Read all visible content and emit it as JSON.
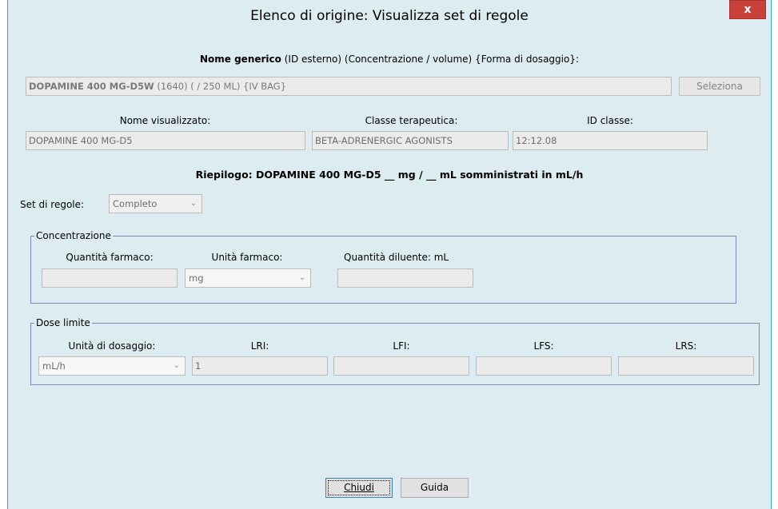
{
  "window": {
    "title": "Elenco di origine: Visualizza set di regole",
    "close_label": "x"
  },
  "generic": {
    "heading_bold": "Nome generico",
    "heading_rest": "(ID esterno) (Concentrazione / volume) {Forma di dosaggio}:",
    "value_bold": "DOPAMINE 400 MG-D5W",
    "value_rest": "(1640) ( / 250 ML) {IV BAG}",
    "select_button": "Seleziona"
  },
  "info": {
    "display_name_label": "Nome visualizzato:",
    "display_name_value": "DOPAMINE 400 MG-D5",
    "class_label": "Classe terapeutica:",
    "class_value": "BETA-ADRENERGIC AGONISTS",
    "class_id_label": "ID classe:",
    "class_id_value": "12:12.08"
  },
  "summary": "Riepilogo: DOPAMINE 400 MG-D5 __ mg / __ mL somministrati in mL/h",
  "ruleset": {
    "label": "Set di regole:",
    "value": "Completo"
  },
  "concentration": {
    "title": "Concentrazione",
    "drug_amount_label": "Quantità farmaco:",
    "drug_amount_value": "",
    "drug_unit_label": "Unità farmaco:",
    "drug_unit_value": "mg",
    "diluent_label": "Quantità diluente: mL",
    "diluent_value": ""
  },
  "dose_limits": {
    "title": "Dose limite",
    "dosing_unit_label": "Unità di dosaggio:",
    "dosing_unit_value": "mL/h",
    "lri_label": "LRI:",
    "lri_value": "1",
    "lfi_label": "LFI:",
    "lfi_value": "",
    "lfs_label": "LFS:",
    "lfs_value": "",
    "lrs_label": "LRS:",
    "lrs_value": ""
  },
  "buttons": {
    "close": "Chiudi",
    "help": "Guida"
  },
  "icons": {
    "close": "close-icon",
    "dropdown": "chevron-down-icon"
  }
}
